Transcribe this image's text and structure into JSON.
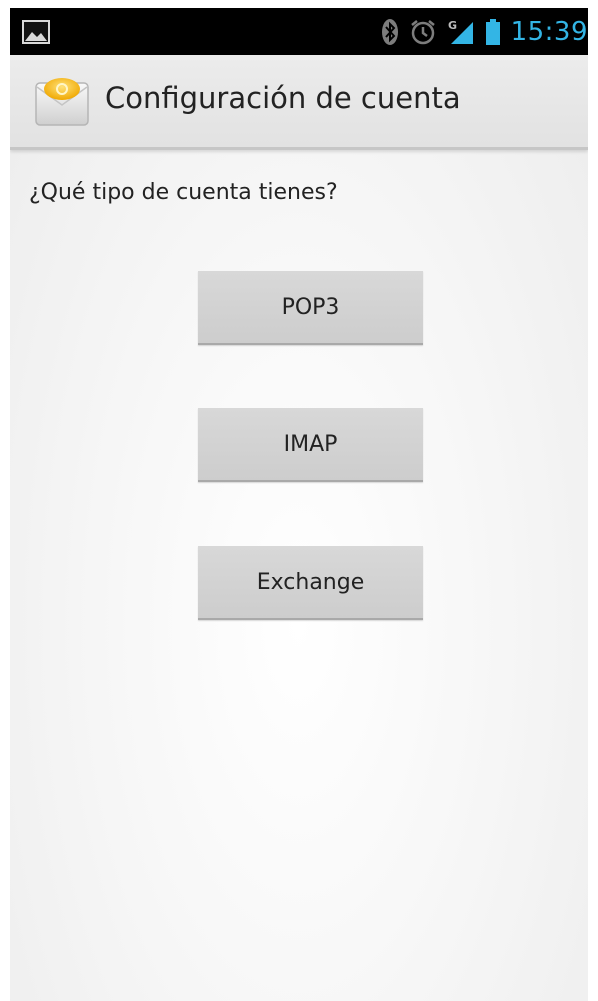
{
  "status_bar": {
    "time": "15:39",
    "time_color": "#33b5e5",
    "icons": [
      "gallery-icon",
      "bluetooth-icon",
      "alarm-icon",
      "signal-icon",
      "battery-icon"
    ],
    "signal_type": "G"
  },
  "action_bar": {
    "title": "Configuración de cuenta",
    "app_icon": "email-app-icon"
  },
  "content": {
    "question": "¿Qué tipo de cuenta tienes?",
    "buttons": [
      {
        "label": "POP3"
      },
      {
        "label": "IMAP"
      },
      {
        "label": "Exchange"
      }
    ]
  }
}
